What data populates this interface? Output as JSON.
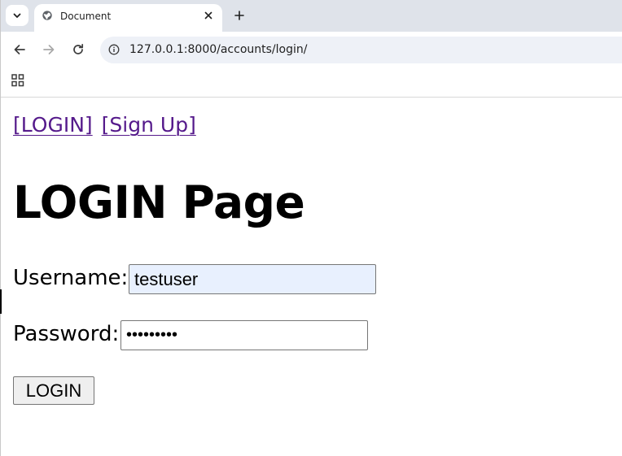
{
  "browser": {
    "tab": {
      "title": "Document",
      "favicon": "globe-icon",
      "close_icon": "close-icon"
    },
    "tab_search_icon": "chevron-down-icon",
    "new_tab_icon": "plus-icon",
    "toolbar": {
      "back_icon": "back-arrow-icon",
      "forward_icon": "forward-arrow-icon",
      "reload_icon": "reload-icon",
      "site_info_icon": "info-icon",
      "url": "127.0.0.1:8000/accounts/login/"
    },
    "bookmarks": {
      "apps_icon": "apps-grid-icon"
    }
  },
  "page": {
    "nav": {
      "login_link": "[LOGIN]",
      "signup_link": "[Sign Up]"
    },
    "title": "LOGIN Page",
    "form": {
      "username_label": "Username:",
      "username_value": "testuser",
      "password_label": "Password:",
      "password_value": "testpass1",
      "submit_label": "LOGIN"
    }
  },
  "colors": {
    "visited_link": "#551a8b",
    "autofill_bg": "#e8f0fe",
    "tabstrip_bg": "#dfe3ea",
    "omnibox_bg": "#eef1f7"
  }
}
